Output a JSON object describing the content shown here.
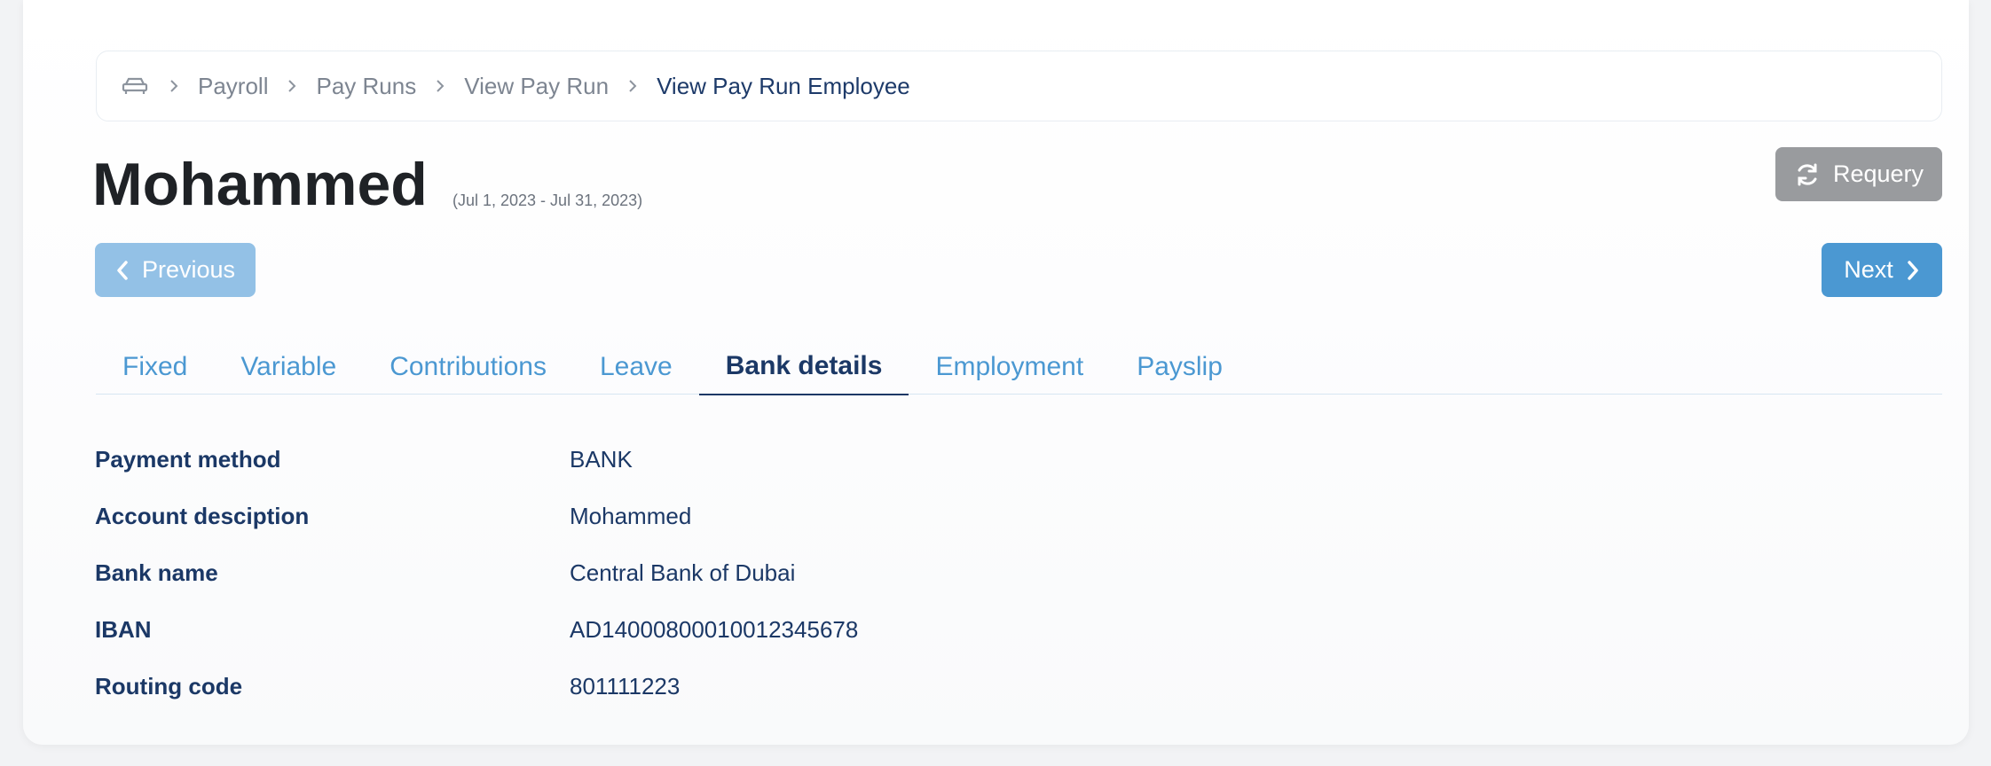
{
  "breadcrumb": {
    "items": [
      "Payroll",
      "Pay Runs",
      "View Pay Run"
    ],
    "current": "View Pay Run Employee"
  },
  "header": {
    "title": "Mohammed",
    "period": "(Jul 1, 2023 - Jul 31, 2023)"
  },
  "actions": {
    "requery_label": "Requery",
    "previous_label": "Previous",
    "next_label": "Next"
  },
  "tabs": [
    {
      "label": "Fixed",
      "active": false
    },
    {
      "label": "Variable",
      "active": false
    },
    {
      "label": "Contributions",
      "active": false
    },
    {
      "label": "Leave",
      "active": false
    },
    {
      "label": "Bank details",
      "active": true
    },
    {
      "label": "Employment",
      "active": false
    },
    {
      "label": "Payslip",
      "active": false
    }
  ],
  "bank_details": [
    {
      "label": "Payment method",
      "value": "BANK"
    },
    {
      "label": "Account desciption",
      "value": "Mohammed"
    },
    {
      "label": "Bank name",
      "value": "Central Bank of Dubai"
    },
    {
      "label": "IBAN",
      "value": "AD1400080001001234567​8"
    },
    {
      "label": "Routing code",
      "value": "801111223"
    }
  ],
  "colors": {
    "accent": "#4b98d2",
    "navy": "#1b3866",
    "disabled": "#93c1e6",
    "neutral": "#999b9e"
  }
}
